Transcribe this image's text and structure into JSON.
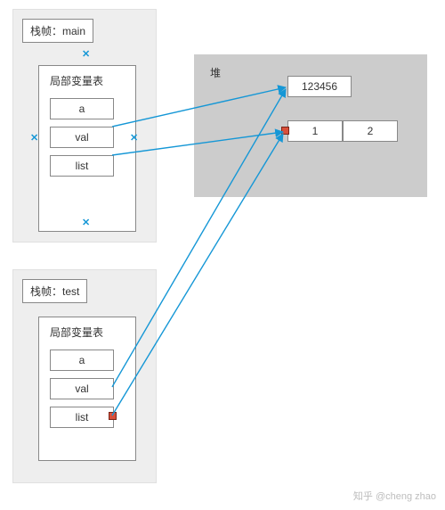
{
  "frames": [
    {
      "title": "栈帧：main",
      "inner_title": "局部变量表",
      "slots": [
        "a",
        "val",
        "list"
      ]
    },
    {
      "title": "栈帧：test",
      "inner_title": "局部变量表",
      "slots": [
        "a",
        "val",
        "list"
      ]
    }
  ],
  "heap": {
    "label": "堆",
    "string_obj": "123456",
    "array": [
      "1",
      "2"
    ]
  },
  "watermark": "知乎 @cheng zhao"
}
